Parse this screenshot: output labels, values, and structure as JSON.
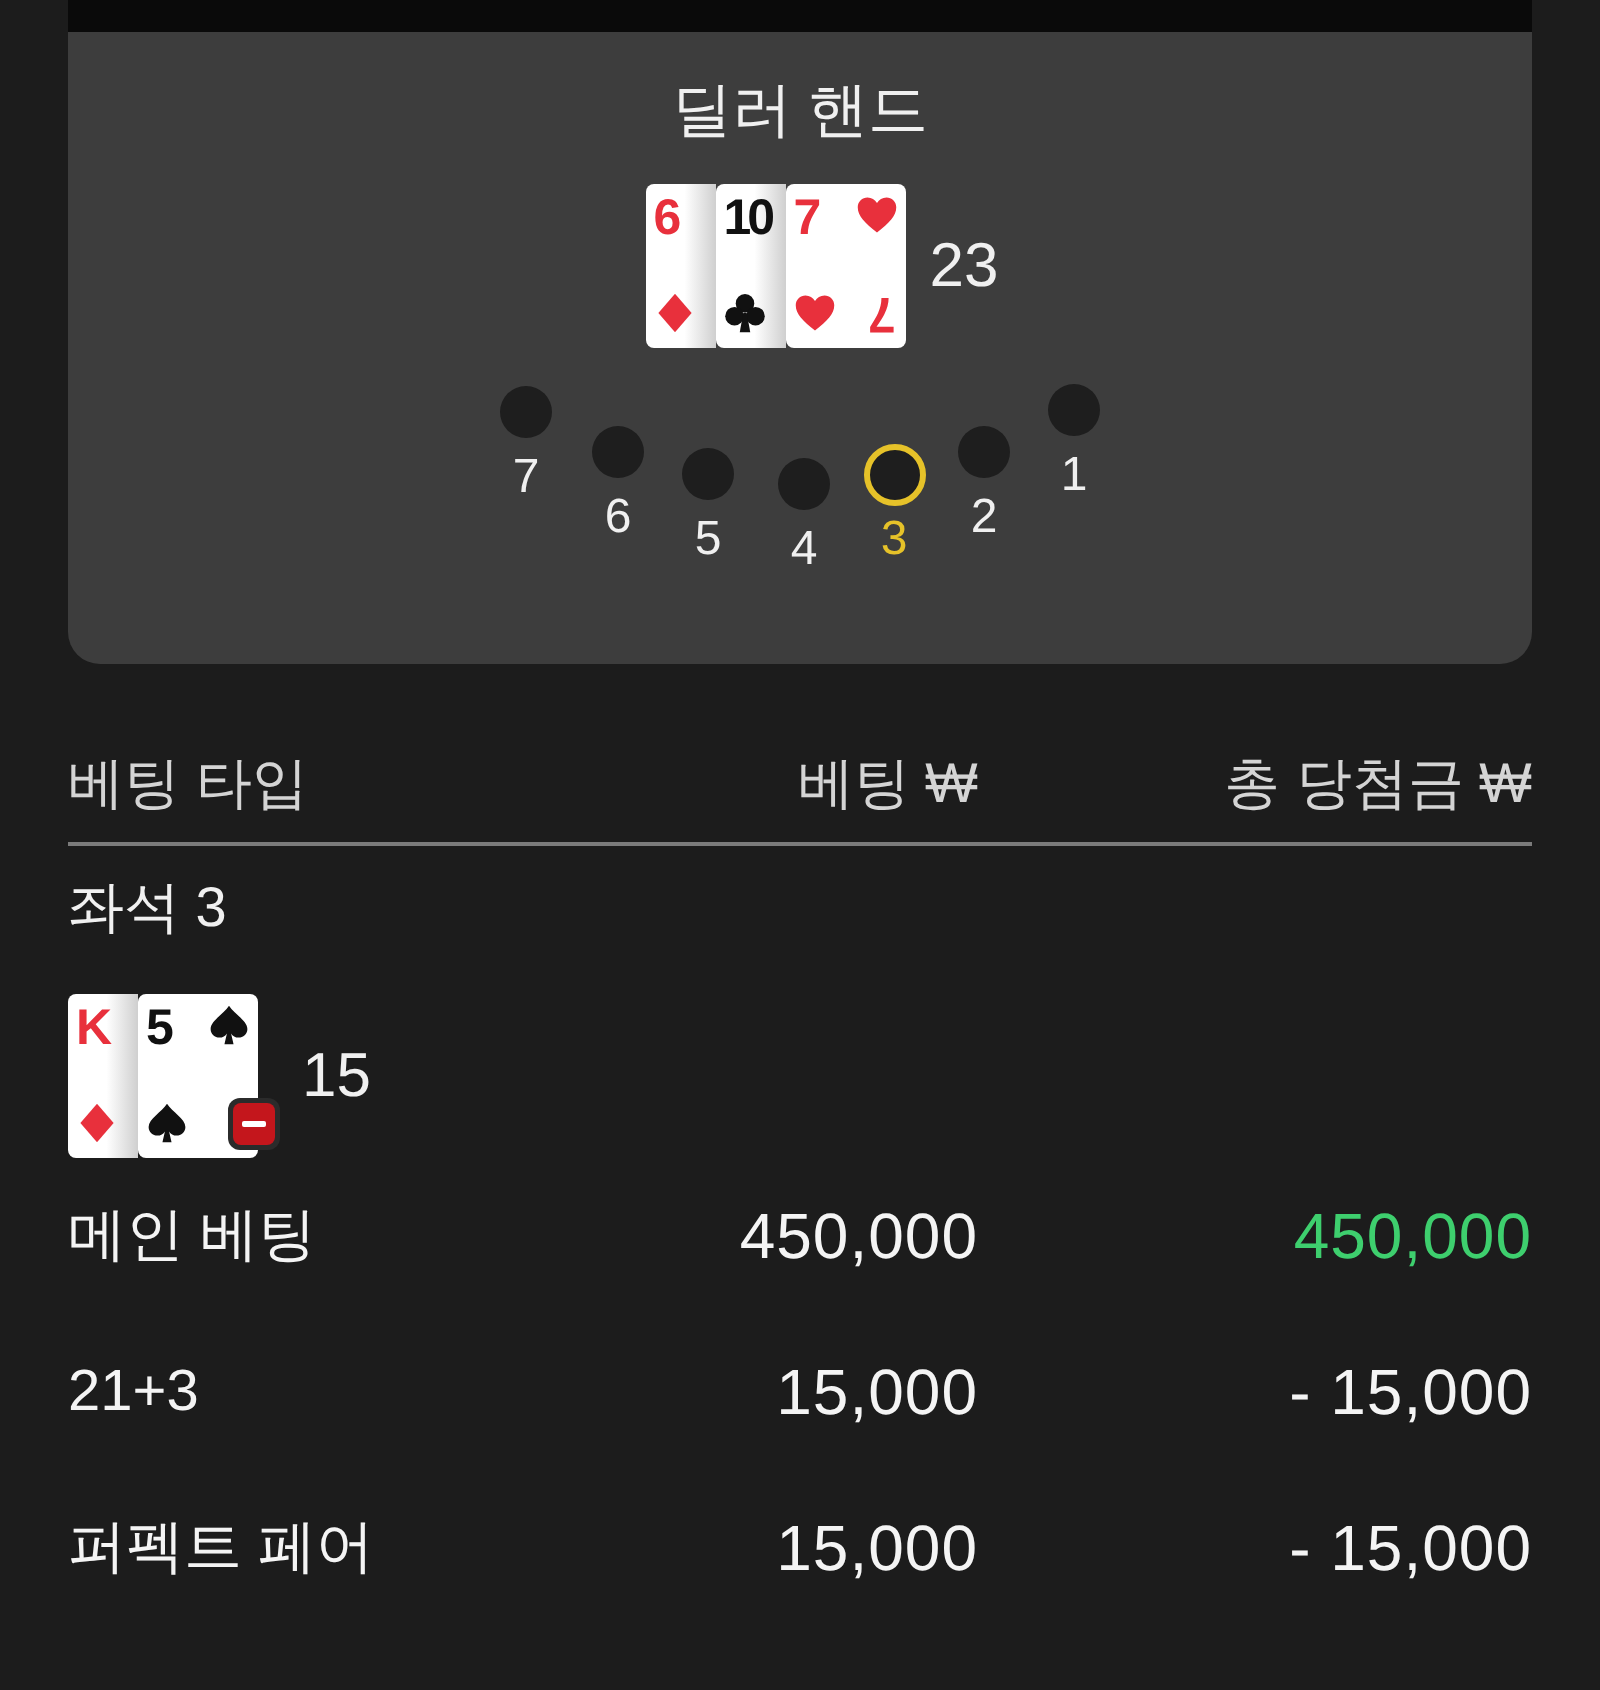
{
  "dealer": {
    "title": "딜러 핸드",
    "cards": [
      {
        "rank": "6",
        "kind": "diamond"
      },
      {
        "rank": "10",
        "kind": "club"
      },
      {
        "rank": "7",
        "kind": "heart",
        "rank_rotated": "7"
      }
    ],
    "total": "23"
  },
  "seats": [
    {
      "label": "7",
      "selected": false
    },
    {
      "label": "6",
      "selected": false
    },
    {
      "label": "5",
      "selected": false
    },
    {
      "label": "4",
      "selected": false
    },
    {
      "label": "3",
      "selected": true
    },
    {
      "label": "2",
      "selected": false
    },
    {
      "label": "1",
      "selected": false
    }
  ],
  "bets_table": {
    "columns": [
      "베팅 타입",
      "베팅 ₩",
      "총 당첨금 ₩"
    ],
    "seat_title": "좌석 3",
    "hand": {
      "cards": [
        {
          "rank": "K",
          "kind": "diamond"
        },
        {
          "rank": "5",
          "kind": "spade"
        }
      ],
      "total": "15",
      "minus_badge": true
    },
    "rows": [
      {
        "type": "메인 베팅",
        "bet": "450,000",
        "payout": "450,000",
        "won": true
      },
      {
        "type": "21+3",
        "bet": "15,000",
        "payout": "- 15,000",
        "won": false
      },
      {
        "type": "퍼펙트 페어",
        "bet": "15,000",
        "payout": "- 15,000",
        "won": false
      }
    ]
  }
}
